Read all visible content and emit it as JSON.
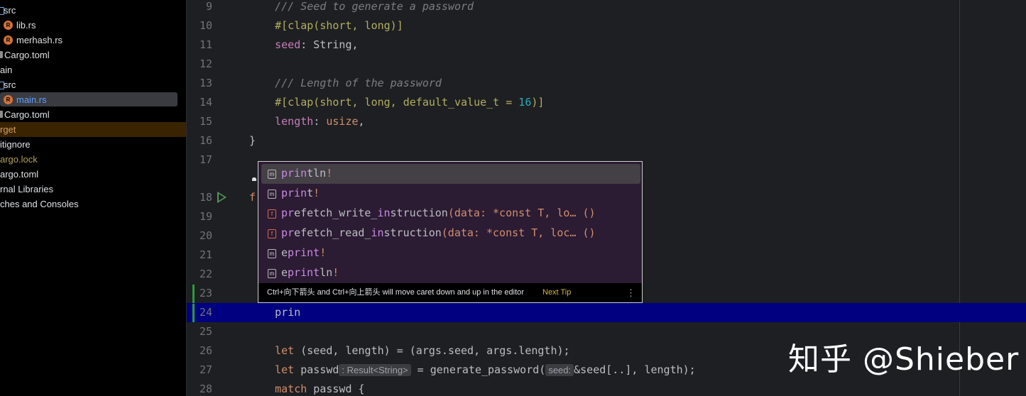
{
  "project_tree": [
    {
      "label": "src",
      "type": "folder"
    },
    {
      "label": "lib.rs",
      "type": "rust"
    },
    {
      "label": "merhash.rs",
      "type": "rust"
    },
    {
      "label": "Cargo.toml",
      "type": "toml"
    },
    {
      "label": "ain",
      "type": "folder"
    },
    {
      "label": "src",
      "type": "folder"
    },
    {
      "label": "main.rs",
      "type": "rust",
      "selected": true
    },
    {
      "label": "Cargo.toml",
      "type": "toml"
    },
    {
      "label": "rget",
      "type": "excluded"
    },
    {
      "label": "itignore",
      "type": "file"
    },
    {
      "label": "argo.lock",
      "type": "lock"
    },
    {
      "label": "argo.toml",
      "type": "file"
    },
    {
      "label": "rnal Libraries",
      "type": "file"
    },
    {
      "label": "ches and Consoles",
      "type": "file"
    }
  ],
  "line_numbers": [
    "9",
    "10",
    "11",
    "12",
    "13",
    "14",
    "15",
    "16",
    "17",
    "18",
    "19",
    "20",
    "21",
    "22",
    "23",
    "24",
    "25",
    "26",
    "27",
    "28"
  ],
  "code": {
    "l9_comment": "/// Seed to generate a password",
    "l10_attr": "#[clap(short, long)]",
    "l11_field": "seed",
    "l11_rest": ": String,",
    "l13_comment": "/// Length of the password",
    "l14_attr": "#[clap(short, long, default_value_t = ",
    "l14_num": "16",
    "l14_end": ")]",
    "l15_field": "length",
    "l15_colon": ": ",
    "l15_type": "usize",
    "l15_end": ",",
    "l16": "}",
    "l18": "f",
    "l24": "prin",
    "l26_kw": "let",
    "l26_rest": " (seed, length) = (args.seed, args.length);",
    "l27_kw": "let",
    "l27_var": " passwd",
    "l27_hint": ": Result<String>",
    "l27_mid": " = generate_password(",
    "l27_hint2": "seed:",
    "l27_end": "&seed[..], length);",
    "l28_kw": "match",
    "l28_rest": " passwd {"
  },
  "completion": {
    "items": [
      {
        "icon": "m",
        "match": "prin",
        "rest": "tln",
        "suffix": "!",
        "selected": true
      },
      {
        "icon": "m",
        "match": "prin",
        "rest": "t",
        "suffix": "!"
      },
      {
        "icon": "f",
        "pre": "",
        "m1": "pr",
        "mid1": "efetch_write_",
        "m2": "in",
        "mid2": "struction",
        "sig": "(data: *const T, lo… ()"
      },
      {
        "icon": "f",
        "pre": "",
        "m1": "pr",
        "mid1": "efetch_read_",
        "m2": "in",
        "mid2": "struction",
        "sig": "(data: *const T, loc… ()"
      },
      {
        "icon": "m",
        "pre": "e",
        "match": "print",
        "rest": "",
        "suffix": "!"
      },
      {
        "icon": "m",
        "pre": "e",
        "match": "print",
        "rest": "ln",
        "suffix": "!"
      }
    ],
    "tip": "Ctrl+向下箭头 and Ctrl+向上箭头 will move caret down and up in the editor",
    "next_tip": "Next Tip",
    "more": "⋮"
  },
  "watermark": "知乎 @Shieber"
}
